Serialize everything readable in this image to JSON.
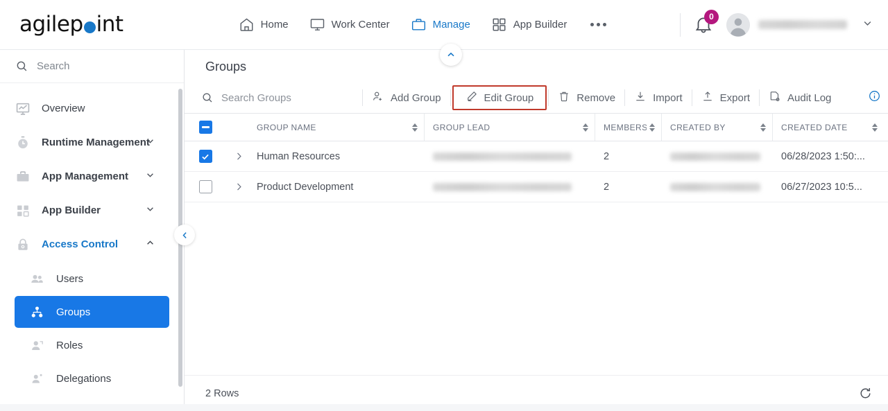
{
  "brand": {
    "name": "agilepoint",
    "name_part1": "agilep",
    "name_part2": "int",
    "dot_color": "#1878c8"
  },
  "topnav": {
    "items": [
      {
        "label": "Home",
        "icon": "home-icon",
        "active": false
      },
      {
        "label": "Work Center",
        "icon": "monitor-icon",
        "active": false
      },
      {
        "label": "Manage",
        "icon": "briefcase-icon",
        "active": true
      },
      {
        "label": "App Builder",
        "icon": "grid-icon",
        "active": false
      }
    ],
    "more_label": "More",
    "notification_count": "0",
    "notification_badge_color": "#b4177e",
    "user_name": "",
    "accent_color": "#1878c8"
  },
  "sidebar": {
    "search_placeholder": "Search",
    "items": [
      {
        "label": "Overview",
        "icon": "chart-monitor-icon",
        "expandable": false,
        "bold": false,
        "selected": false
      },
      {
        "label": "Runtime Management",
        "icon": "stopwatch-icon",
        "expandable": true,
        "expanded": false,
        "bold": true,
        "selected": false
      },
      {
        "label": "App Management",
        "icon": "briefcase-icon",
        "expandable": true,
        "expanded": false,
        "bold": true,
        "selected": false
      },
      {
        "label": "App Builder",
        "icon": "grid-icon",
        "expandable": true,
        "expanded": false,
        "bold": true,
        "selected": false
      },
      {
        "label": "Access Control",
        "icon": "lock-icon",
        "expandable": true,
        "expanded": true,
        "bold": true,
        "accent": true,
        "selected": false
      }
    ],
    "subitems": [
      {
        "label": "Users",
        "icon": "users-icon",
        "selected": false
      },
      {
        "label": "Groups",
        "icon": "group-tree-icon",
        "selected": true
      },
      {
        "label": "Roles",
        "icon": "role-person-icon",
        "selected": false
      },
      {
        "label": "Delegations",
        "icon": "delegation-person-icon",
        "selected": false
      }
    ],
    "selected_color": "#1878e6"
  },
  "main": {
    "page_title": "Groups",
    "toolbar": {
      "search_placeholder": "Search Groups",
      "buttons": [
        {
          "label": "Add Group",
          "icon": "person-add-icon",
          "highlighted": false
        },
        {
          "label": "Edit Group",
          "icon": "pencil-icon",
          "highlighted": true
        },
        {
          "label": "Remove",
          "icon": "trash-icon",
          "highlighted": false
        },
        {
          "label": "Import",
          "icon": "download-icon",
          "highlighted": false
        },
        {
          "label": "Export",
          "icon": "upload-icon",
          "highlighted": false
        },
        {
          "label": "Audit Log",
          "icon": "audit-doc-icon",
          "highlighted": false
        }
      ],
      "info_icon": "info-icon",
      "highlight_color": "#c0392b"
    },
    "table": {
      "select_all_state": "indeterminate",
      "columns": [
        {
          "label": "GROUP NAME",
          "sortable": true
        },
        {
          "label": "GROUP LEAD",
          "sortable": true
        },
        {
          "label": "MEMBERS",
          "sortable": true
        },
        {
          "label": "CREATED BY",
          "sortable": true
        },
        {
          "label": "CREATED DATE",
          "sortable": true
        }
      ],
      "rows": [
        {
          "selected": true,
          "group_name": "Human Resources",
          "group_lead": "",
          "members": "2",
          "created_by": "",
          "created_date": "06/28/2023 1:50:..."
        },
        {
          "selected": false,
          "group_name": "Product Development",
          "group_lead": "",
          "members": "2",
          "created_by": "",
          "created_date": "06/27/2023 10:5..."
        }
      ]
    },
    "footer": {
      "rows_label": "2 Rows",
      "refresh_icon": "refresh-icon"
    }
  }
}
